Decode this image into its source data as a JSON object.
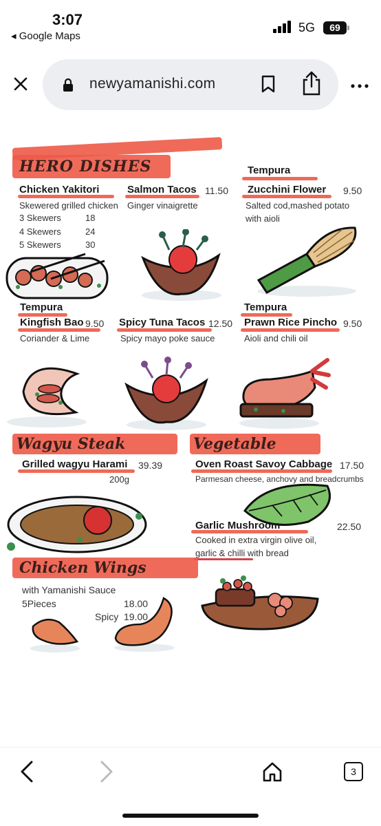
{
  "status": {
    "time": "3:07",
    "back_app": "◂ Google Maps",
    "network": "5G",
    "battery": "69"
  },
  "browser": {
    "url": "newyamanishi.com",
    "tab_count": "3"
  },
  "menu": {
    "hero_title": "HERO DISHES",
    "items": {
      "chicken_yakitori": {
        "name": "Chicken Yakitori",
        "desc": "Skewered grilled chicken",
        "options": [
          {
            "label": "3  Skewers",
            "price": "18"
          },
          {
            "label": "4  Skewers",
            "price": "24"
          },
          {
            "label": "5  Skewers",
            "price": "30"
          }
        ]
      },
      "salmon_tacos": {
        "name": "Salmon Tacos",
        "price": "11.50",
        "desc": "Ginger vinaigrette"
      },
      "tempura_zucchini": {
        "prefix": "Tempura",
        "name": "Zucchini Flower",
        "price": "9.50",
        "desc_line1": "Salted cod,mashed potato",
        "desc_line2": "with aioli"
      },
      "tempura_kingfish": {
        "prefix": "Tempura",
        "name": "Kingfish Bao",
        "price": "9.50",
        "desc": "Coriander & Lime"
      },
      "spicy_tuna": {
        "name": "Spicy Tuna Tacos",
        "price": "12.50",
        "desc": "Spicy mayo poke sauce"
      },
      "tempura_prawn": {
        "prefix": "Tempura",
        "name": "Prawn Rice Pincho",
        "price": "9.50",
        "desc": "Aioli and chili oil"
      },
      "grilled_wagyu": {
        "name": "Grilled wagyu Harami",
        "price": "39.39",
        "weight": "200g"
      },
      "savoy_cabbage": {
        "name": "Oven Roast Savoy Cabbage",
        "price": "17.50",
        "desc": "Parmesan cheese, anchovy and breadcrumbs"
      },
      "garlic_mushroom": {
        "name": "Garlic Mushroom",
        "price": "22.50",
        "desc_line1": "Cooked in extra virgin olive oil,",
        "desc_line2": "garlic & chilli with bread"
      },
      "chicken_wings": {
        "desc": "with Yamanishi Sauce",
        "pieces": "5Pieces",
        "price": "18.00",
        "spicy_label": "Spicy",
        "spicy_price": "19.00"
      }
    },
    "section_titles": {
      "wagyu": "Wagyu Steak",
      "vegetable": "Vegetable",
      "wings": "Chicken Wings"
    }
  },
  "colors": {
    "brush_red": "#ee5a48",
    "urlbar_bg": "#eceef1"
  }
}
